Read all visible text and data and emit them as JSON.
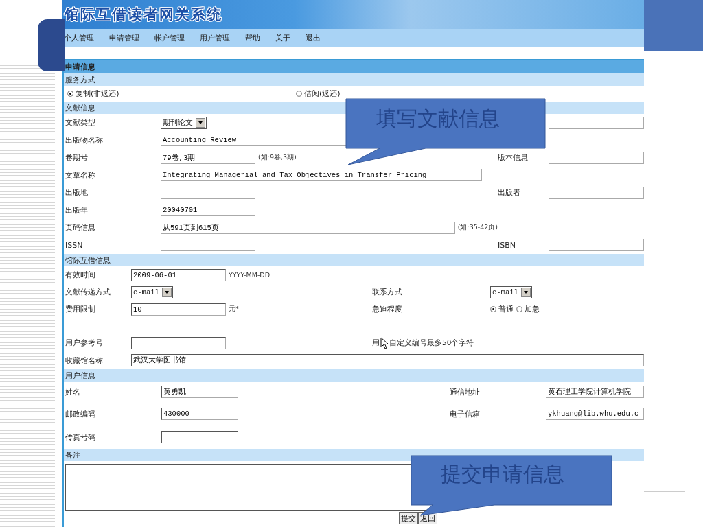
{
  "header": {
    "title": "馆际互借读者网关系统"
  },
  "nav": [
    {
      "label": "个人管理"
    },
    {
      "label": "申请管理"
    },
    {
      "label": "帐户管理"
    },
    {
      "label": "用户管理"
    },
    {
      "label": "帮助"
    },
    {
      "label": "关于"
    },
    {
      "label": "退出"
    }
  ],
  "form": {
    "title": "申请信息",
    "service": {
      "heading": "服务方式",
      "options": [
        {
          "label": "复制(非返还)",
          "selected": true
        },
        {
          "label": "借阅(返还)",
          "selected": false
        }
      ]
    },
    "sections": [
      {
        "heading": "文献信息",
        "rows": [
          {
            "label": "文献类型",
            "field": {
              "kind": "select",
              "value": "期刊论文"
            },
            "right": {
              "field": {
                "kind": "fill"
              }
            }
          },
          {
            "label": "出版物名称",
            "field": {
              "kind": "long",
              "value": "Accounting Review"
            }
          },
          {
            "label": "卷期号",
            "field": {
              "kind": "short",
              "value": "79卷,3期"
            },
            "hint": "(如:9卷,3期)",
            "right": {
              "label": "版本信息",
              "field": {
                "kind": "fill"
              }
            }
          },
          {
            "label": "文章名称",
            "field": {
              "kind": "long",
              "value": "Integrating Managerial and Tax Objectives in Transfer Pricing"
            }
          },
          {
            "label": "出版地",
            "field": {
              "kind": "short"
            },
            "right": {
              "label": "出版者",
              "field": {
                "kind": "fill"
              }
            }
          },
          {
            "label": "出版年",
            "field": {
              "kind": "short",
              "value": "20040701"
            }
          },
          {
            "label": "页码信息",
            "field": {
              "kind": "long",
              "value": "从591页到615页"
            },
            "hint": "(如:35-42页)"
          },
          {
            "label": "ISSN",
            "field": {
              "kind": "short"
            },
            "right": {
              "label": "ISBN",
              "field": {
                "kind": "fill"
              }
            }
          }
        ]
      },
      {
        "heading": "馆际互借信息",
        "rows": [
          {
            "label": "有效时间",
            "field": {
              "kind": "short",
              "value": "2009-06-01"
            },
            "hint": "YYYY-MM-DD"
          },
          {
            "label": "文献传递方式",
            "field": {
              "kind": "select",
              "value": "e-mail"
            },
            "right": {
              "label": "联系方式",
              "field": {
                "kind": "select",
                "value": "e-mail"
              }
            }
          },
          {
            "label": "费用限制",
            "field": {
              "kind": "short",
              "value": "10"
            },
            "hint": "元*",
            "right": {
              "label": "急迫程度",
              "options": [
                {
                  "label": "普通",
                  "selected": true
                },
                {
                  "label": "加急",
                  "selected": false
                }
              ]
            }
          },
          {
            "label": "用户参考号",
            "field": {
              "kind": "short"
            },
            "right": {
              "notes": [
                "用",
                "自定义编号最多50个字符"
              ]
            }
          },
          {
            "label": "收藏馆名称",
            "field": {
              "kind": "full",
              "value": "武汉大学图书馆"
            }
          }
        ]
      },
      {
        "heading": "用户信息",
        "rows": [
          {
            "label": "姓名",
            "field": {
              "kind": "medium",
              "value": "黄勇凯"
            },
            "right": {
              "label": "通信地址",
              "field": {
                "kind": "fill",
                "value": "黄石理工学院计算机学院"
              }
            }
          },
          {
            "label": "邮政编码",
            "field": {
              "kind": "medium",
              "value": "430000"
            },
            "right": {
              "label": "电子信箱",
              "field": {
                "kind": "fill",
                "value": "ykhuang@lib.whu.edu.c"
              }
            }
          },
          {
            "label": "传真号码",
            "field": {
              "kind": "medium"
            }
          }
        ]
      }
    ],
    "remarks": {
      "heading": "备注"
    },
    "buttons": [
      {
        "label": "提交"
      },
      {
        "label": "返回"
      }
    ]
  },
  "callouts": [
    {
      "text": "填写文献信息"
    },
    {
      "text": "提交申请信息"
    }
  ]
}
